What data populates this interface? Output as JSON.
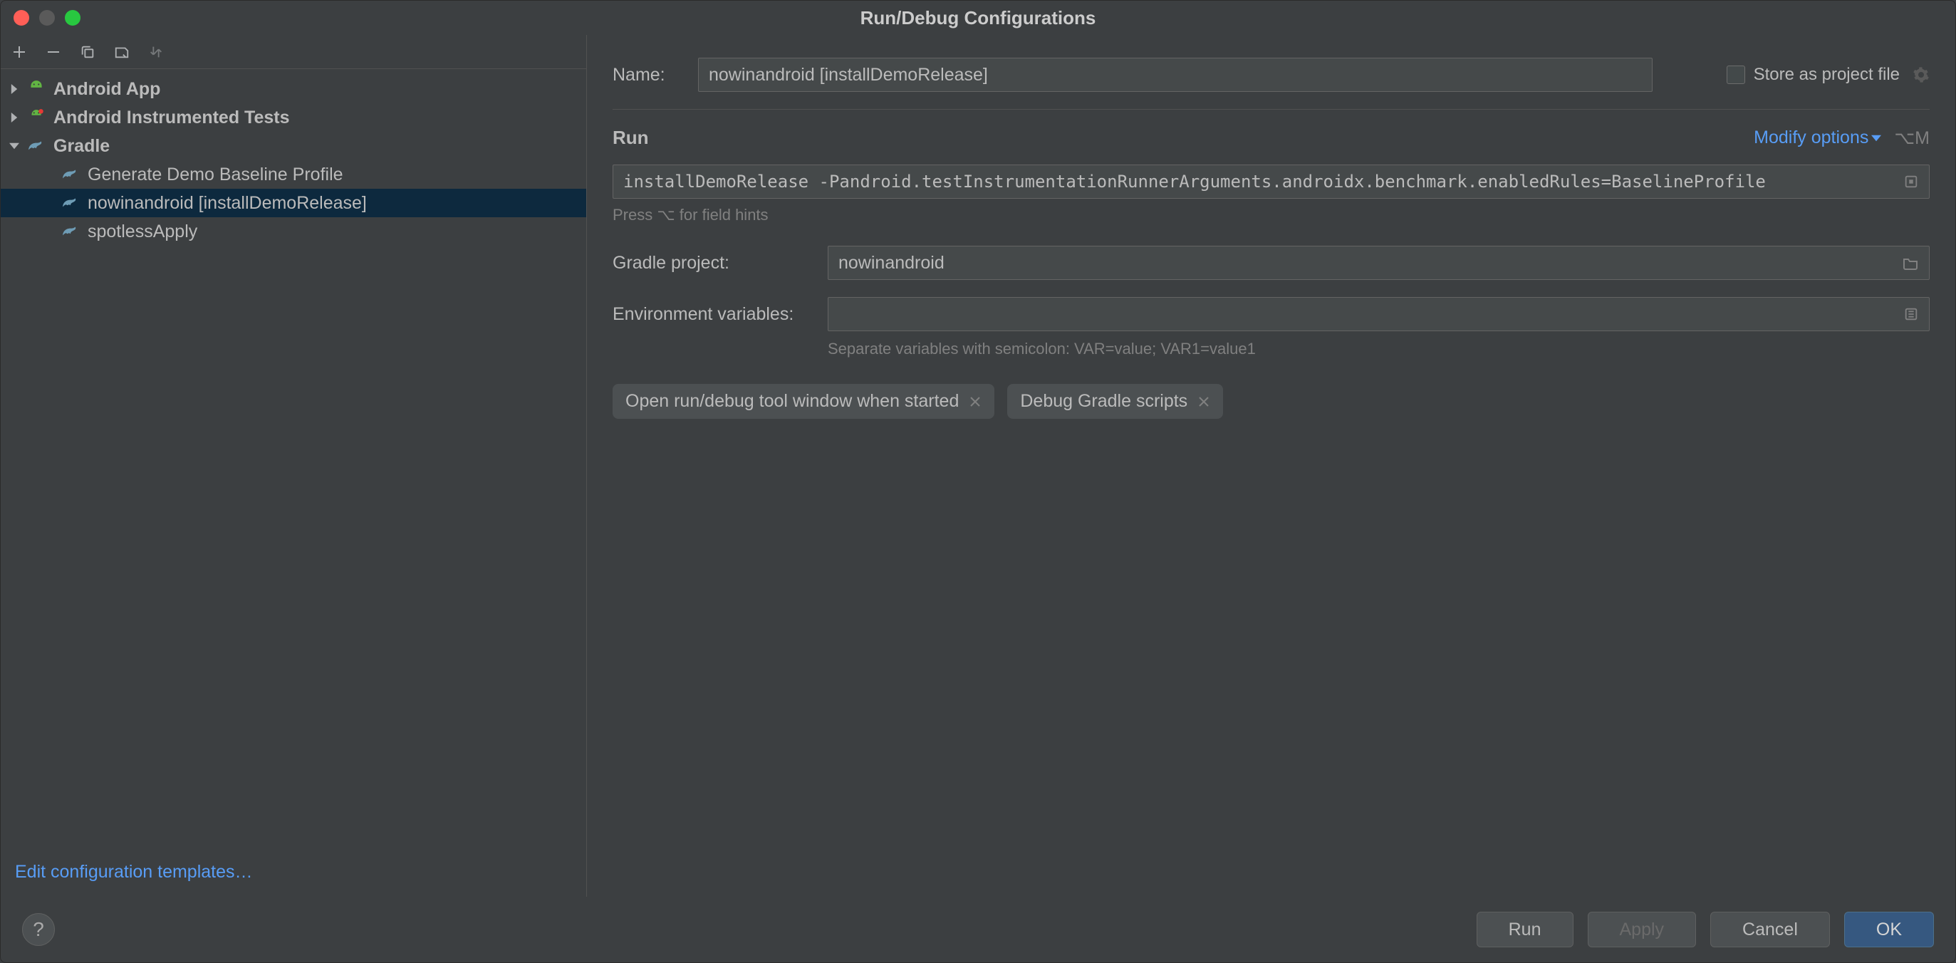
{
  "titlebar": {
    "title": "Run/Debug Configurations"
  },
  "sidebar": {
    "groups": [
      {
        "label": "Android App",
        "bold": true,
        "iconColor": "#62b543"
      },
      {
        "label": "Android Instrumented Tests",
        "bold": true,
        "iconColor": "#62b543"
      },
      {
        "label": "Gradle",
        "bold": true
      }
    ],
    "gradleChildren": [
      {
        "label": "Generate Demo Baseline Profile"
      },
      {
        "label": "nowinandroid [installDemoRelease]",
        "selected": true
      },
      {
        "label": "spotlessApply"
      }
    ],
    "editTemplates": "Edit configuration templates…"
  },
  "form": {
    "nameLabel": "Name:",
    "nameValue": "nowinandroid [installDemoRelease]",
    "storeAsFile": "Store as project file",
    "runSection": "Run",
    "modifyOptions": "Modify options",
    "modifyShortcut": "⌥M",
    "command": "installDemoRelease -Pandroid.testInstrumentationRunnerArguments.androidx.benchmark.enabledRules=BaselineProfile",
    "hint": "Press ⌥ for field hints",
    "gradleProjectLabel": "Gradle project:",
    "gradleProjectValue": "nowinandroid",
    "envLabel": "Environment variables:",
    "envValue": "",
    "envHint": "Separate variables with semicolon: VAR=value; VAR1=value1",
    "chips": [
      {
        "label": "Open run/debug tool window when started"
      },
      {
        "label": "Debug Gradle scripts"
      }
    ]
  },
  "buttons": {
    "run": "Run",
    "apply": "Apply",
    "cancel": "Cancel",
    "ok": "OK"
  }
}
